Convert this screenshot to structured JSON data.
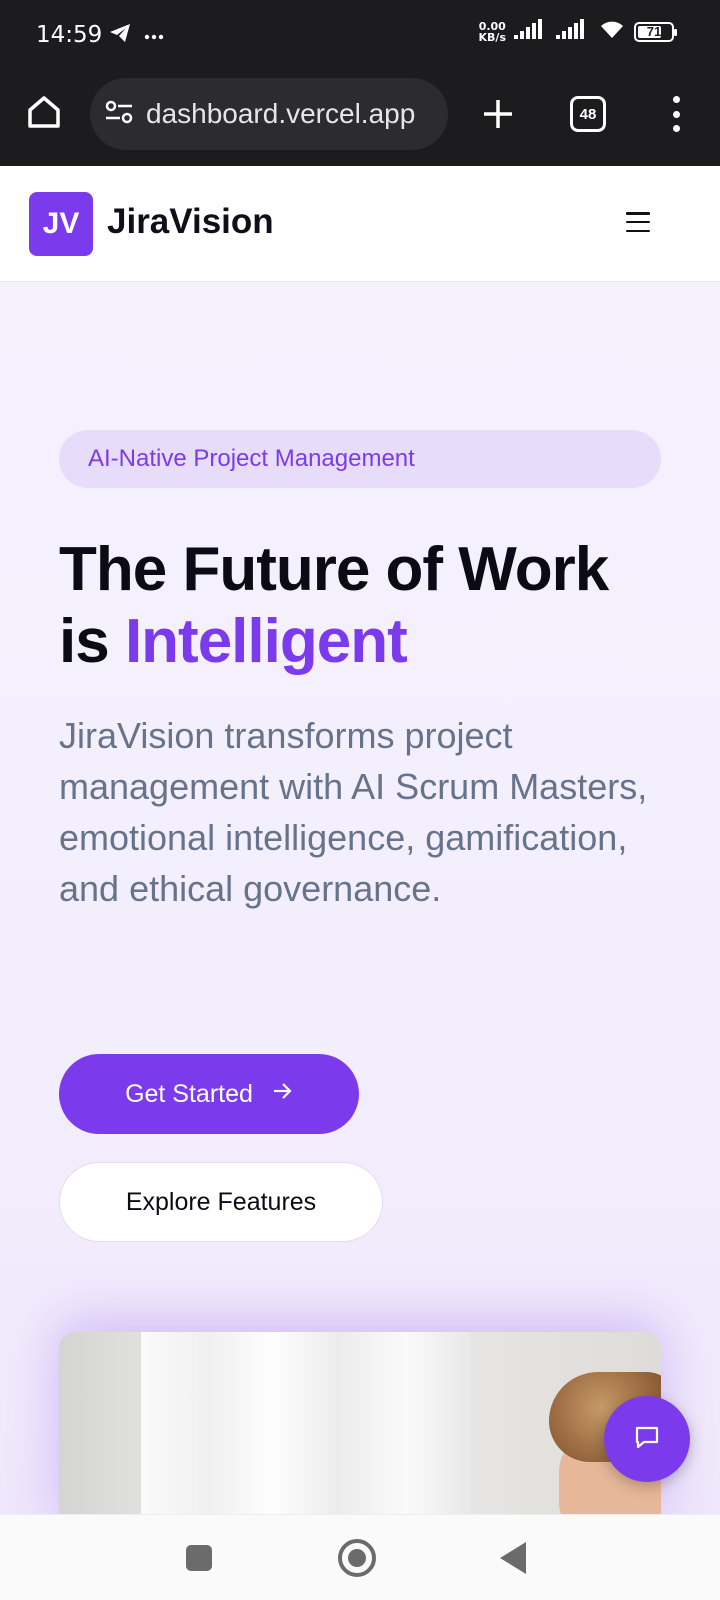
{
  "status_bar": {
    "time": "14:59",
    "net_speed_value": "0.00",
    "net_speed_unit": "KB/s",
    "battery": "71",
    "battery_level": 0.71
  },
  "browser": {
    "url": "dashboard.vercel.app",
    "tab_count": "48"
  },
  "site_header": {
    "logo_initials": "JV",
    "brand_name": "JiraVision"
  },
  "hero": {
    "badge": "AI-Native Project Management",
    "headline_line1": "The Future of Work",
    "headline_is": "is",
    "headline_accent": "Intelligent",
    "description": "JiraVision transforms project management with AI Scrum Masters, emotional intelligence, gamification, and ethical governance.",
    "cta_primary": "Get Started",
    "cta_secondary": "Explore Features"
  },
  "icons": {
    "telegram": "telegram-icon",
    "more": "more-dots-icon",
    "signal": "signal-icon",
    "wifi": "wifi-icon",
    "home": "home-icon",
    "site_settings": "tune-icon",
    "new_tab": "plus-icon",
    "overflow": "vertical-dots-icon",
    "menu": "hamburger-icon",
    "arrow": "arrow-right-icon",
    "chat": "chat-icon"
  },
  "colors": {
    "accent": "#7c3aed",
    "badge_bg": "#e7ddfb",
    "text_dark": "#0b0b16",
    "text_muted": "#66738a",
    "chrome_dark": "#1c1c1e"
  }
}
